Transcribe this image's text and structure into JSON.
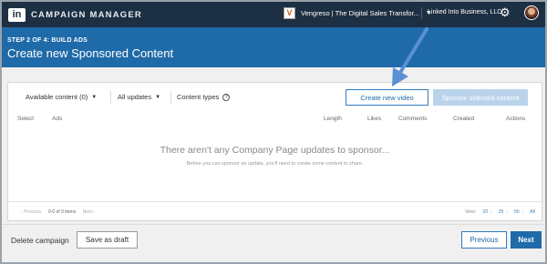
{
  "app": {
    "logo_text": "in",
    "title": "CAMPAIGN MANAGER"
  },
  "account": {
    "logo_letter": "V",
    "name": "Vengreso | The Digital Sales Transfor...",
    "business": "Linked Into Business, LLC"
  },
  "header": {
    "step": "STEP 2 OF 4: BUILD ADS",
    "title": "Create new Sponsored Content"
  },
  "filters": {
    "available": "Available content (0)",
    "updates": "All updates",
    "content_types": "Content types"
  },
  "actions": {
    "create_video": "Create new video",
    "sponsor_selected": "Sponsor selected content"
  },
  "columns": [
    "Select",
    "Ads",
    "Length",
    "Likes",
    "Comments",
    "Created",
    "Actions"
  ],
  "empty": {
    "title": "There aren't any Company Page updates to sponsor...",
    "subtitle": "Before you can sponsor an update, you'll need to create some content to share."
  },
  "pager": {
    "previous": "Previous",
    "count": "0-0 of 0 items",
    "next": "Next",
    "view_label": "View:",
    "options": [
      "10",
      "25",
      "50",
      "All"
    ]
  },
  "footer": {
    "delete": "Delete campaign",
    "save_draft": "Save as draft",
    "previous": "Previous",
    "next": "Next"
  },
  "colors": {
    "topbar": "#1d2f42",
    "header": "#1f6aa8",
    "accent": "#2f7bbf",
    "arrow": "#5b8fd6"
  }
}
